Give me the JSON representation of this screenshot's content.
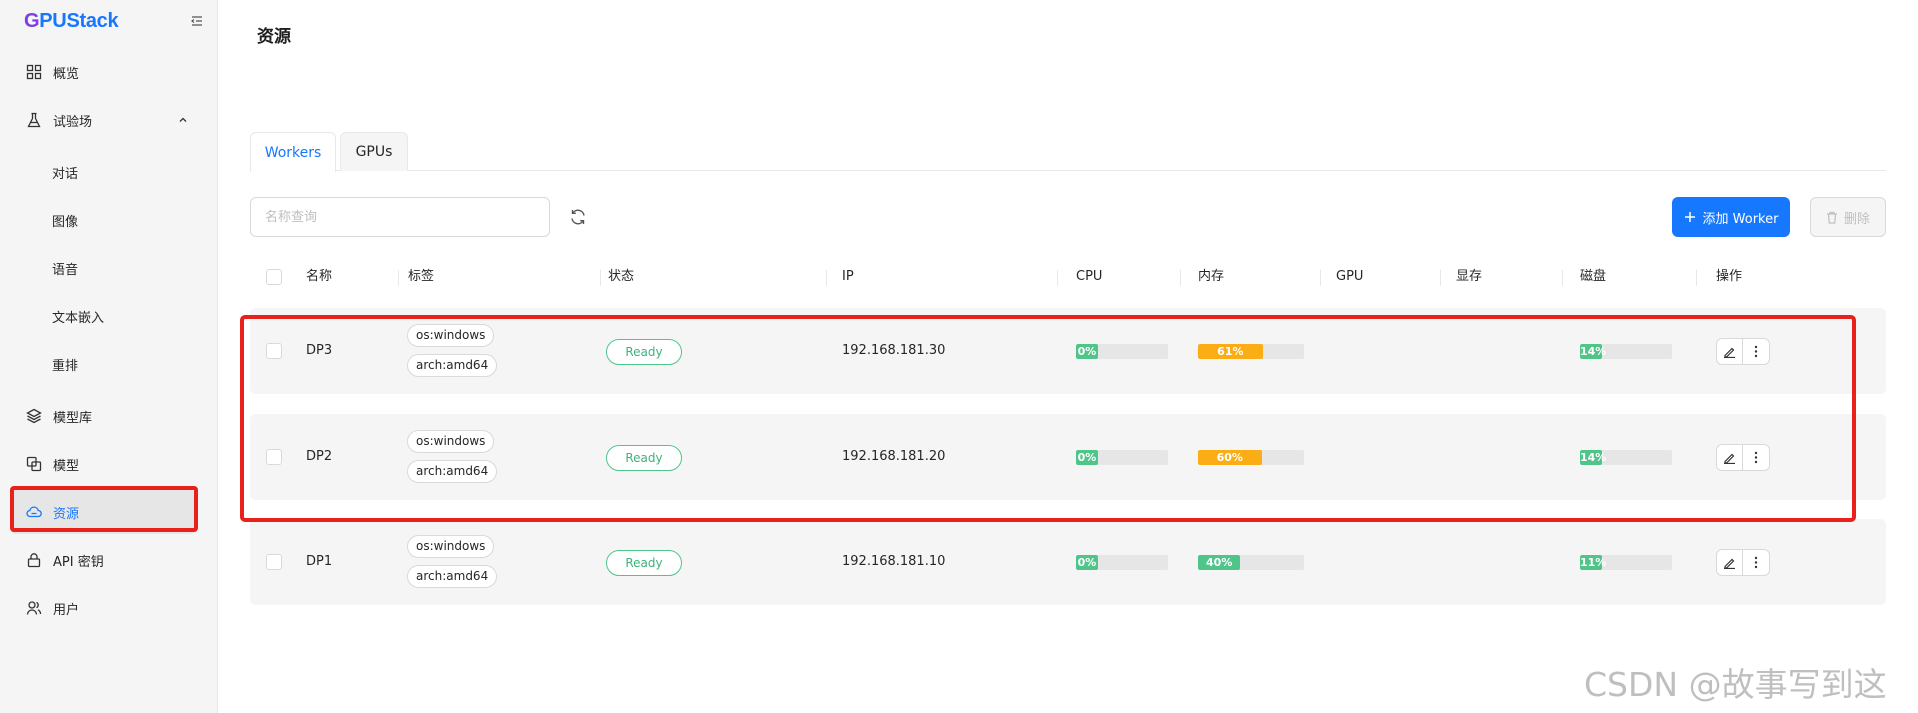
{
  "app": {
    "logo_g": "G",
    "logo_rest": "PUStack"
  },
  "sidebar": {
    "items": [
      {
        "label": "概览",
        "icon": "dashboard-icon"
      },
      {
        "label": "试验场",
        "icon": "flask-icon",
        "expanded": true
      },
      {
        "label": "对话"
      },
      {
        "label": "图像"
      },
      {
        "label": "语音"
      },
      {
        "label": "文本嵌入"
      },
      {
        "label": "重排"
      },
      {
        "label": "模型库",
        "icon": "layers-icon"
      },
      {
        "label": "模型",
        "icon": "model-icon"
      },
      {
        "label": "资源",
        "icon": "cloud-icon",
        "active": true
      },
      {
        "label": "API 密钥",
        "icon": "lock-icon"
      },
      {
        "label": "用户",
        "icon": "users-icon"
      }
    ]
  },
  "page": {
    "title": "资源"
  },
  "tabs": [
    {
      "label": "Workers",
      "active": true
    },
    {
      "label": "GPUs",
      "active": false
    }
  ],
  "toolbar": {
    "search_placeholder": "名称查询",
    "search_value": "",
    "add_label": "添加 Worker",
    "delete_label": "删除"
  },
  "table": {
    "headers": {
      "name": "名称",
      "labels": "标签",
      "status": "状态",
      "ip": "IP",
      "cpu": "CPU",
      "memory": "内存",
      "gpu": "GPU",
      "vram": "显存",
      "disk": "磁盘",
      "actions": "操作"
    },
    "rows": [
      {
        "name": "DP3",
        "tags": [
          "os:windows",
          "arch:amd64"
        ],
        "status": "Ready",
        "ip": "192.168.181.30",
        "cpu": {
          "label": "0%",
          "value": 0
        },
        "memory": {
          "label": "61%",
          "value": 61
        },
        "disk": {
          "label": "14%",
          "value": 14
        }
      },
      {
        "name": "DP2",
        "tags": [
          "os:windows",
          "arch:amd64"
        ],
        "status": "Ready",
        "ip": "192.168.181.20",
        "cpu": {
          "label": "0%",
          "value": 0
        },
        "memory": {
          "label": "60%",
          "value": 60
        },
        "disk": {
          "label": "14%",
          "value": 14
        }
      },
      {
        "name": "DP1",
        "tags": [
          "os:windows",
          "arch:amd64"
        ],
        "status": "Ready",
        "ip": "192.168.181.10",
        "cpu": {
          "label": "0%",
          "value": 0
        },
        "memory": {
          "label": "40%",
          "value": 40
        },
        "disk": {
          "label": "11%",
          "value": 11
        }
      }
    ]
  },
  "colors": {
    "primary": "#1677ff",
    "ok": "#52c41a",
    "success_bar": "#4fc58a",
    "warn_bar": "#faad14",
    "highlight": "#e8211b"
  },
  "watermark": "CSDN @故事写到这"
}
